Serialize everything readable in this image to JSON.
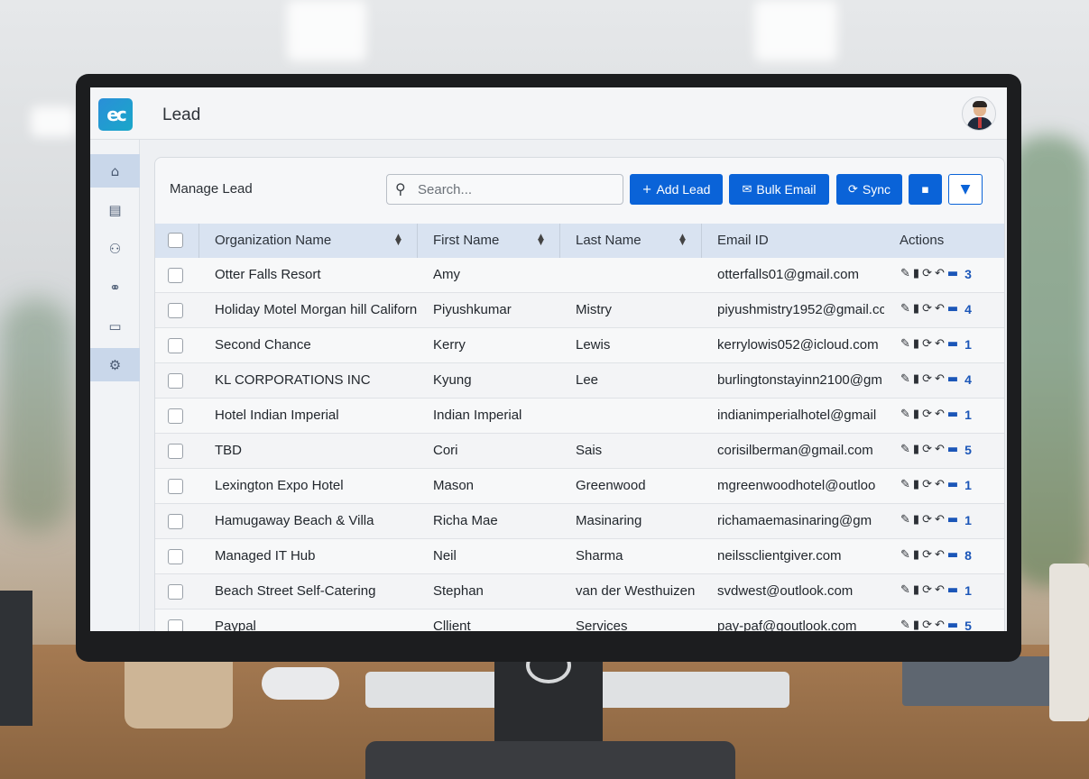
{
  "app": {
    "logo_text": "ec",
    "title": "Lead"
  },
  "sidebar": {
    "items": [
      {
        "icon": "home-icon",
        "glyph": "⌂",
        "active": true
      },
      {
        "icon": "clipboard-icon",
        "glyph": "▤",
        "active": false
      },
      {
        "icon": "user-settings-icon",
        "glyph": "⚇",
        "active": false
      },
      {
        "icon": "users-icon",
        "glyph": "⚭",
        "active": false
      },
      {
        "icon": "document-icon",
        "glyph": "▭",
        "active": false
      },
      {
        "icon": "gear-icon",
        "glyph": "⚙",
        "active": true
      }
    ]
  },
  "card": {
    "title": "Manage Lead",
    "search": {
      "placeholder": "Search...",
      "value": ""
    },
    "buttons": {
      "add_lead": "Add Lead",
      "bulk_email": "Bulk Email",
      "sync": "Sync"
    }
  },
  "table": {
    "headers": {
      "org": "Organization Name",
      "first": "First Name",
      "last": "Last Name",
      "email": "Email ID",
      "actions": "Actions"
    },
    "rows": [
      {
        "org": "Otter Falls Resort",
        "first": "Amy",
        "last": "",
        "email": "otterfalls01@gmail.com",
        "count": "3"
      },
      {
        "org": "Holiday Motel Morgan hill Californ",
        "first": "Piyushkumar",
        "last": "Mistry",
        "email": "piyushmistry1952@gmail.cc",
        "count": "4"
      },
      {
        "org": "Second Chance",
        "first": "Kerry",
        "last": "Lewis",
        "email": "kerrylowis052@icloud.com",
        "count": "1"
      },
      {
        "org": "KL CORPORATIONS INC",
        "first": "Kyung",
        "last": "Lee",
        "email": "burlingtonstayinn2100@gm",
        "count": "4"
      },
      {
        "org": "Hotel Indian Imperial",
        "first": "Indian Imperial",
        "last": "",
        "email": "indianimperialhotel@gmail",
        "count": "1"
      },
      {
        "org": "TBD",
        "first": "Cori",
        "last": "Sais",
        "email": "corisilberman@gmail.com",
        "count": "5"
      },
      {
        "org": "Lexington Expo Hotel",
        "first": "Mason",
        "last": "Greenwood",
        "email": "mgreenwoodhotel@outloo",
        "count": "1"
      },
      {
        "org": "Hamugaway Beach & Villa",
        "first": "Richa Mae",
        "last": "Masinaring",
        "email": "richamaemasinaring@gm",
        "count": "1"
      },
      {
        "org": "Managed IT Hub",
        "first": "Neil",
        "last": "Sharma",
        "email": "neilssclientgiver.com",
        "count": "8"
      },
      {
        "org": "Beach Street Self-Catering",
        "first": "Stephan",
        "last": "van der Westhuizen",
        "email": "svdwest@outlook.com",
        "count": "1"
      },
      {
        "org": "Paypal",
        "first": "Cllient",
        "last": "Services",
        "email": "pay-paf@goutlook.com",
        "count": "5"
      }
    ]
  },
  "colors": {
    "primary": "#0a63d8",
    "header_row": "#d9e3f1",
    "sidebar_active": "#c9d7ea"
  }
}
